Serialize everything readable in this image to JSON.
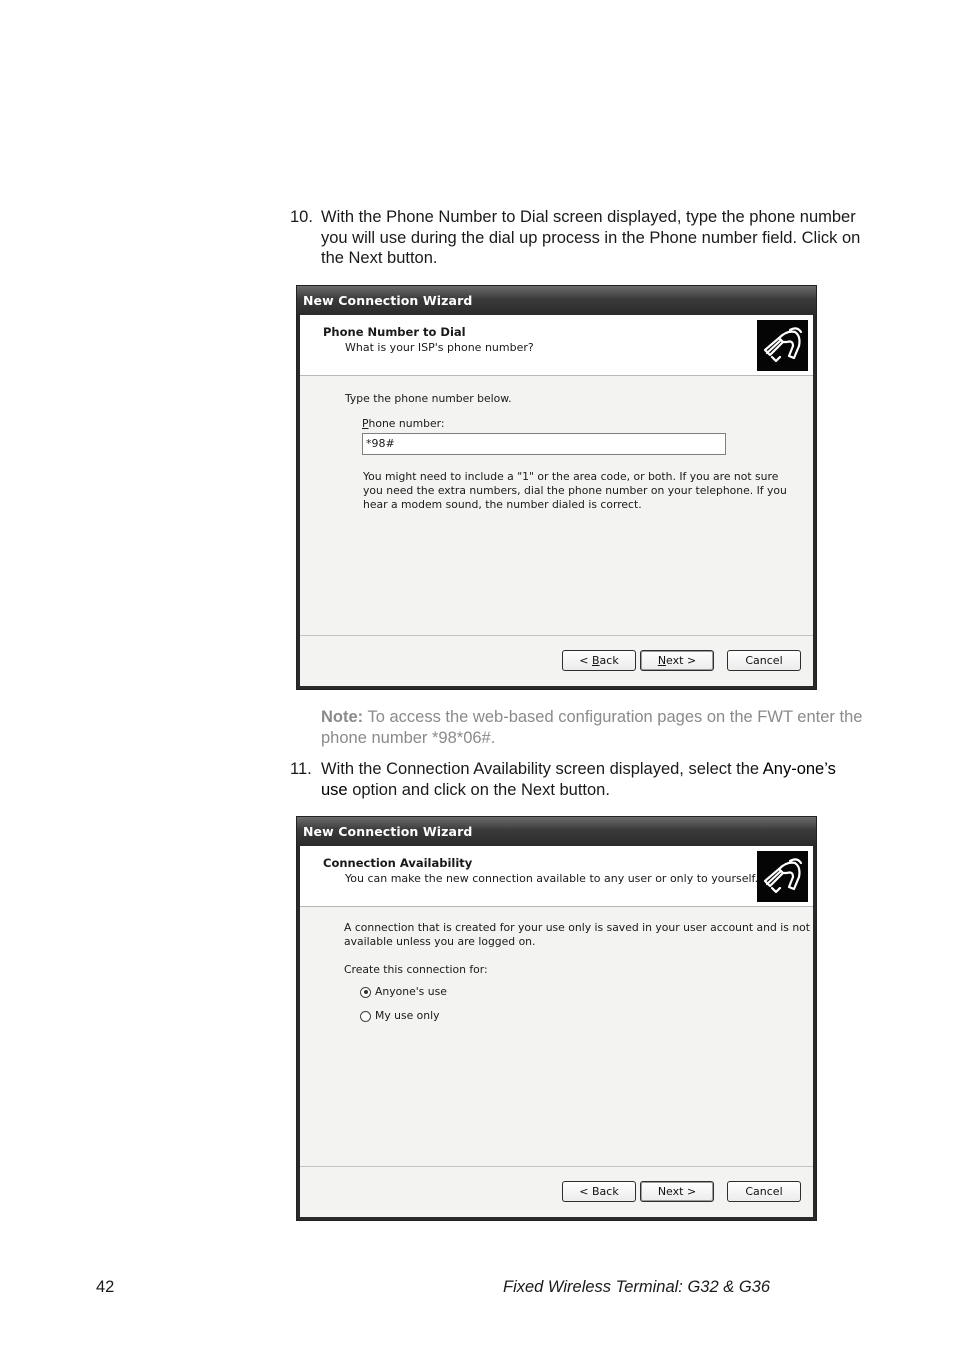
{
  "steps": [
    {
      "number": "10.",
      "text": "With the Phone Number to Dial screen displayed, type the phone number you will use during the dial up process in the Phone number field.  Click on the Next button."
    },
    {
      "number": "11.",
      "text_before": "With the Connection Availability screen displayed, select the ",
      "highlight": "Any-one’s use",
      "text_after": " option and click on the Next button."
    }
  ],
  "note": {
    "label": "Note:",
    "text": " To access the web-based configuration pages on the FWT enter the phone number *98*06#."
  },
  "wizard1": {
    "title": "New Connection Wizard",
    "header_title": "Phone Number to Dial",
    "header_subtitle": "What is your ISP's phone number?",
    "icon": "phone-handset-icon",
    "instruction": "Type the phone number below.",
    "field_label_accel": "P",
    "field_label_rest": "hone number:",
    "field_value": "*98#",
    "help_text_lines": [
      "You might need to include a \"1\" or the area code, or both. If you are not sure",
      "you need the extra numbers, dial the phone number on your telephone. If you",
      "hear a modem sound, the number dialed is correct."
    ],
    "buttons": {
      "back_prefix": "< ",
      "back_accel": "B",
      "back_rest": "ack",
      "next_accel": "N",
      "next_rest": "ext >",
      "cancel": "Cancel"
    }
  },
  "wizard2": {
    "title": "New Connection Wizard",
    "header_title": "Connection Availability",
    "header_subtitle": "You can make the new connection available to any user or only to yourself.",
    "icon": "phone-handset-icon",
    "description_lines": [
      "A connection that is created for your use only is saved in your user account and is not",
      "available unless you are logged on."
    ],
    "create_label": "Create this connection for:",
    "options": [
      {
        "label": "Anyone's use",
        "selected": true
      },
      {
        "label": "My use only",
        "selected": false
      }
    ],
    "buttons": {
      "back": "< Back",
      "next": "Next >",
      "cancel": "Cancel"
    }
  },
  "footer": {
    "page_number": "42",
    "doc_title": "Fixed Wireless Terminal: G32 & G36"
  }
}
